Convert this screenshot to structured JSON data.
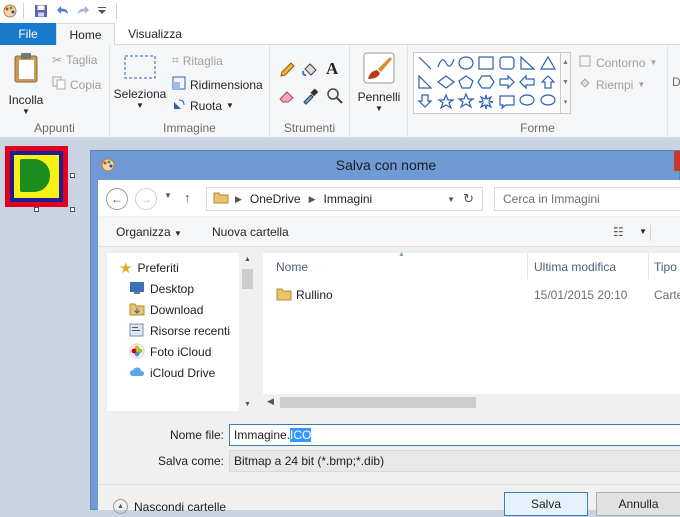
{
  "ribbon": {
    "tabs": {
      "file": "File",
      "home": "Home",
      "view": "Visualizza"
    },
    "clipboard": {
      "paste": "Incolla",
      "cut": "Taglia",
      "copy": "Copia",
      "group": "Appunti"
    },
    "image": {
      "select": "Seleziona",
      "crop": "Ritaglia",
      "resize": "Ridimensiona",
      "rotate": "Ruota",
      "group": "Immagine"
    },
    "tools": {
      "group": "Strumenti"
    },
    "brushes": {
      "label": "Pennelli"
    },
    "shapes": {
      "outline": "Contorno",
      "fill": "Riempi",
      "group": "Forme",
      "next_group_initial": "D"
    }
  },
  "dialog": {
    "title": "Salva con nome",
    "breadcrumb": [
      "OneDrive",
      "Immagini"
    ],
    "search_placeholder": "Cerca in Immagini",
    "commands": {
      "organize": "Organizza",
      "new_folder": "Nuova cartella"
    },
    "nav": {
      "favorites": "Preferiti",
      "items": [
        "Desktop",
        "Download",
        "Risorse recenti",
        "Foto iCloud",
        "iCloud Drive"
      ]
    },
    "columns": {
      "name": "Nome",
      "modified": "Ultima modifica",
      "type": "Tipo"
    },
    "files": [
      {
        "name": "Rullino",
        "modified": "15/01/2015 20:10",
        "type": "Carte"
      }
    ],
    "filename_label": "Nome file:",
    "filename_base": "Immagine.",
    "filename_selected": "ICO",
    "savetype_label": "Salva come:",
    "savetype_value": "Bitmap a 24 bit (*.bmp;*.dib)",
    "hide_folders": "Nascondi cartelle",
    "save": "Salva",
    "cancel": "Annulla"
  },
  "colors": {
    "file_tab": "#1979ca",
    "dialog_frame": "#6f9ad3",
    "selection": "#3399ff"
  }
}
